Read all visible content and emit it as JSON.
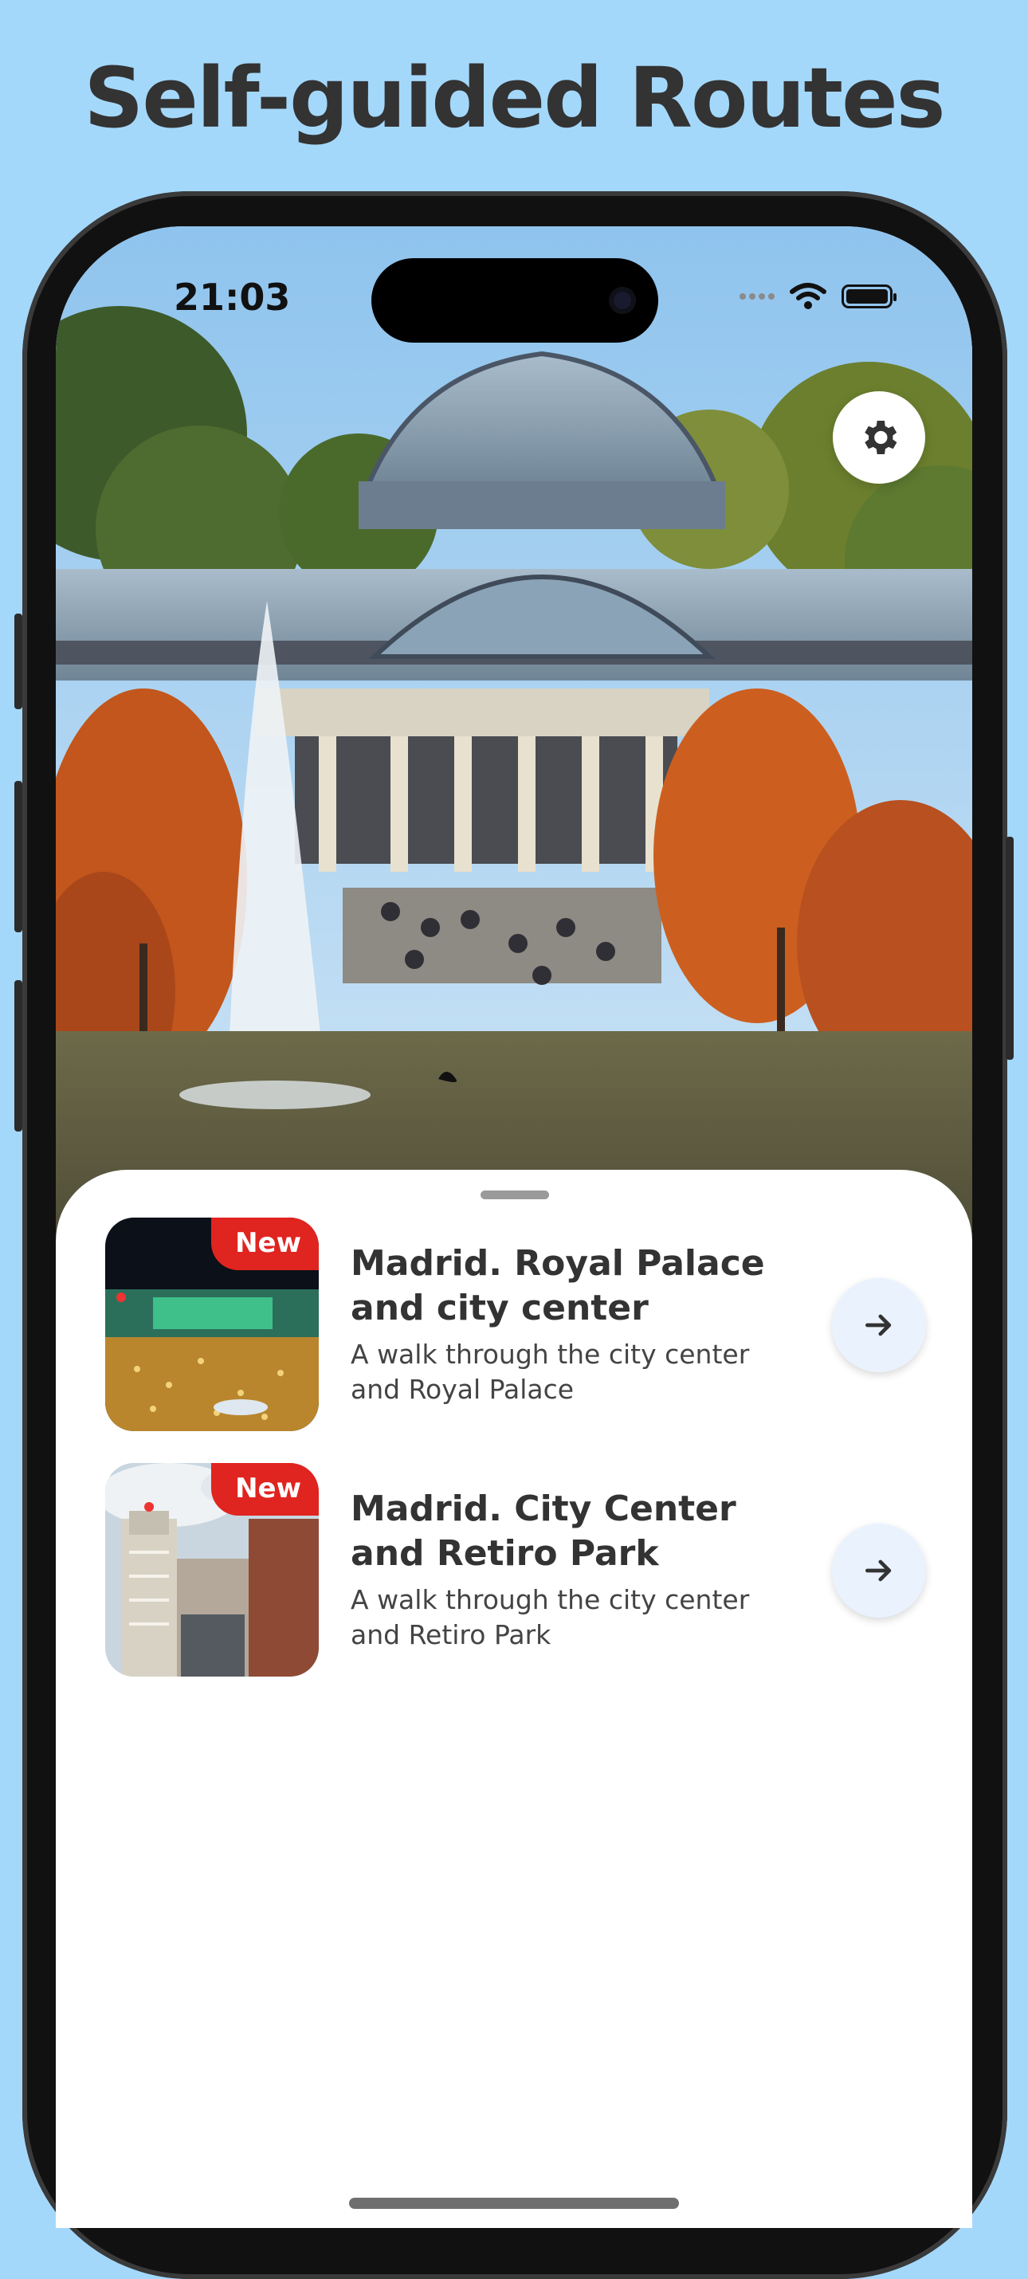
{
  "page": {
    "headline": "Self-guided Routes",
    "background_color": "#a4d8fb"
  },
  "status_bar": {
    "time": "21:03",
    "icons": [
      "cellular-signal-icon",
      "wifi-icon",
      "battery-icon"
    ]
  },
  "hero": {
    "image": "Crystal Palace in Retiro Park with fountain and autumn trees",
    "settings_icon": "gear-icon"
  },
  "routes": [
    {
      "badge": "New",
      "title": "Madrid. Royal Palace and city center",
      "description": "A walk through the city center and Royal Palace",
      "action_icon": "arrow-right-icon"
    },
    {
      "badge": "New",
      "title": "Madrid. City Center and Retiro Park",
      "description": "A walk through the city center and Retiro Park",
      "action_icon": "arrow-right-icon"
    }
  ],
  "colors": {
    "badge": "#e0241f",
    "title_text": "#333333",
    "arrow_button_bg": "#eaf3fd"
  }
}
